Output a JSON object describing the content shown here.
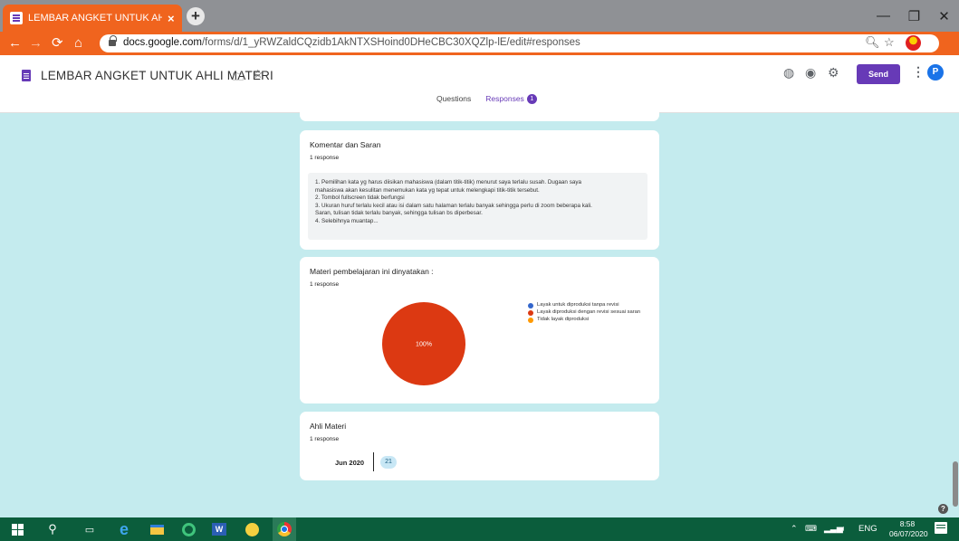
{
  "browser": {
    "tab_title": "LEMBAR ANGKET UNTUK AHLI MATERI",
    "tab_close": "×",
    "new_tab": "+",
    "url_domain": "docs.google.com",
    "url_path": "/forms/d/1_yRWZaldCQzidb1AkNTXSHoind0DHeCBC30XQZlp-lE/edit#responses",
    "window_controls": {
      "minimize": "—",
      "maximize": "❐",
      "close": "✕"
    },
    "accent_color": "#f0641e"
  },
  "form_header": {
    "title": "LEMBAR ANGKET UNTUK AHLI MATERI",
    "send_label": "Send",
    "avatar_letter": "P",
    "tabs": [
      {
        "label": "Questions"
      },
      {
        "label": "Responses",
        "badge": "1"
      }
    ],
    "accent_color": "#673ab7"
  },
  "cards": {
    "komentar": {
      "title": "Komentar dan Saran",
      "count": "1 response",
      "response_lines": [
        "1. Pemilihan kata yg harus diisikan mahasiswa (dalam titik-titik) menurut saya terlalu susah. Dugaan saya",
        "mahasiswa akan kesulitan menemukan kata yg tepat untuk melengkapi titik-titik tersebut.",
        "2. Tombol fullscreen tidak berfungsi",
        "3. Ukuran huruf terlalu kecil atau isi dalam satu halaman terlalu banyak sehingga perlu di zoom beberapa kali.",
        "Saran, tulisan tidak terlalu banyak, sehingga tulisan bs diperbesar.",
        "4. Selebihnya muantap..."
      ]
    },
    "materi": {
      "title": "Materi pembelajaran ini dinyatakan :",
      "count": "1 response"
    },
    "ahli": {
      "title": "Ahli Materi",
      "count": "1 response",
      "month": "Jun 2020",
      "day": "21"
    }
  },
  "chart_data": {
    "type": "pie",
    "categories": [
      "Layak untuk diproduksi tanpa revisi",
      "Layak diproduksi dengan revisi sesuai saran",
      "Tidak layak diproduksi"
    ],
    "values": [
      0,
      100,
      0
    ],
    "colors": [
      "#3366cc",
      "#dc3912",
      "#ff9900"
    ],
    "slice_label": "100%",
    "legend_position": "right"
  },
  "taskbar": {
    "language": "ENG",
    "time": "8:58",
    "date": "06/07/2020",
    "word_label": "W",
    "color": "#0b5d3c"
  }
}
